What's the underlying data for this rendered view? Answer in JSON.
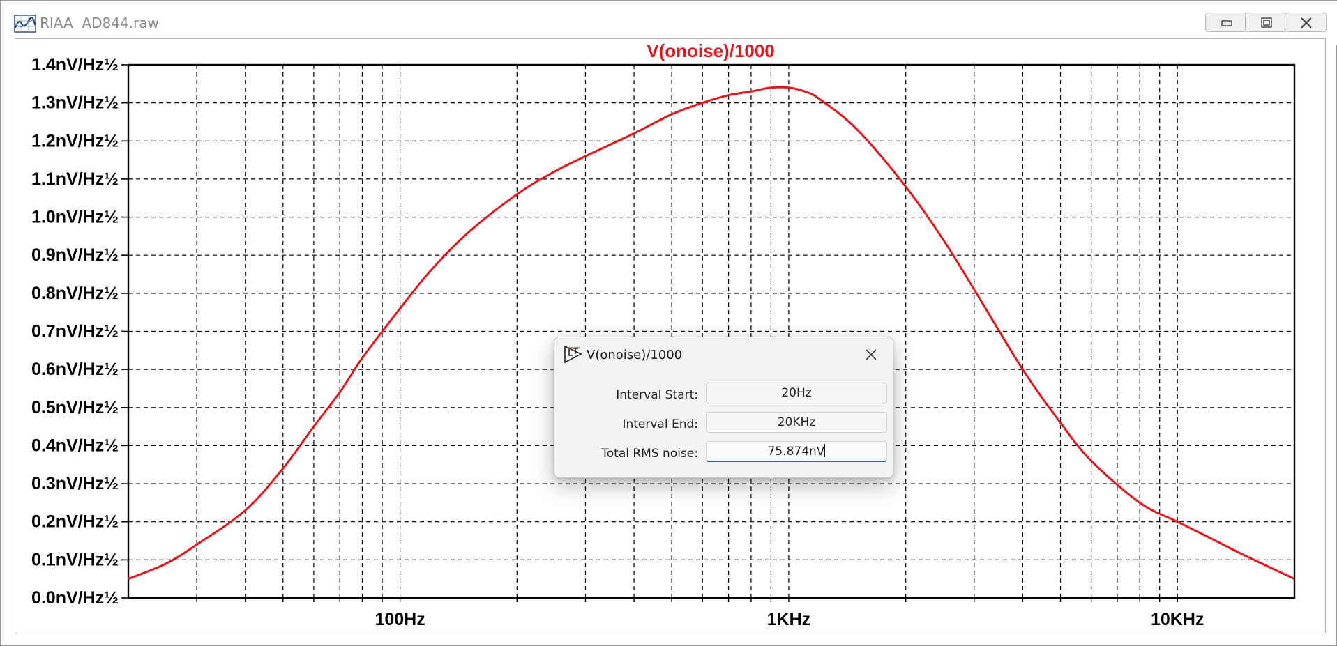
{
  "window": {
    "title": "RIAA  AD844.raw",
    "buttons": [
      "minimize",
      "maximize",
      "close"
    ],
    "icon": "waveform-icon"
  },
  "chart_data": {
    "type": "line",
    "title": "V(onoise)/1000",
    "title_color": "#e8141a",
    "line_color": "#e8141a",
    "xlabel": "",
    "ylabel": "",
    "x_scale": "log",
    "xlim": [
      20,
      20000
    ],
    "ylim": [
      0.0,
      1.4
    ],
    "grid": true,
    "grid_style": "dashed",
    "x_tick_labels": [
      {
        "value": 100,
        "label": "100Hz"
      },
      {
        "value": 1000,
        "label": "1KHz"
      },
      {
        "value": 10000,
        "label": "10KHz"
      }
    ],
    "y_tick_labels": [
      {
        "value": 1.4,
        "label": "1.4nV/Hz½"
      },
      {
        "value": 1.3,
        "label": "1.3nV/Hz½"
      },
      {
        "value": 1.2,
        "label": "1.2nV/Hz½"
      },
      {
        "value": 1.1,
        "label": "1.1nV/Hz½"
      },
      {
        "value": 1.0,
        "label": "1.0nV/Hz½"
      },
      {
        "value": 0.9,
        "label": "0.9nV/Hz½"
      },
      {
        "value": 0.8,
        "label": "0.8nV/Hz½"
      },
      {
        "value": 0.7,
        "label": "0.7nV/Hz½"
      },
      {
        "value": 0.6,
        "label": "0.6nV/Hz½"
      },
      {
        "value": 0.5,
        "label": "0.5nV/Hz½"
      },
      {
        "value": 0.4,
        "label": "0.4nV/Hz½"
      },
      {
        "value": 0.3,
        "label": "0.3nV/Hz½"
      },
      {
        "value": 0.2,
        "label": "0.2nV/Hz½"
      },
      {
        "value": 0.1,
        "label": "0.1nV/Hz½"
      },
      {
        "value": 0.0,
        "label": "0.0nV/Hz½"
      }
    ],
    "series": [
      {
        "x": [
          20,
          25,
          30,
          40,
          50,
          60,
          70,
          80,
          100,
          120,
          150,
          200,
          250,
          300,
          400,
          500,
          600,
          700,
          800,
          900,
          1000,
          1100,
          1200,
          1500,
          2000,
          2500,
          3000,
          4000,
          5000,
          6000,
          8000,
          10000,
          12000,
          15000,
          20000
        ],
        "y": [
          0.05,
          0.09,
          0.14,
          0.23,
          0.34,
          0.45,
          0.54,
          0.63,
          0.76,
          0.86,
          0.96,
          1.06,
          1.12,
          1.16,
          1.22,
          1.27,
          1.3,
          1.32,
          1.33,
          1.34,
          1.34,
          1.33,
          1.31,
          1.23,
          1.08,
          0.94,
          0.81,
          0.6,
          0.46,
          0.36,
          0.25,
          0.2,
          0.16,
          0.11,
          0.05
        ]
      }
    ]
  },
  "dialog": {
    "title": "V(onoise)/1000",
    "icon": "ltspice-icon",
    "fields": [
      {
        "label": "Interval Start:",
        "value": "20Hz"
      },
      {
        "label": "Interval End:",
        "value": "20KHz"
      },
      {
        "label": "Total RMS noise:",
        "value": "75.874nV"
      }
    ]
  },
  "colors": {
    "trace": "#e8141a",
    "grid": "#000000",
    "focus_underline": "#2a62b4"
  }
}
